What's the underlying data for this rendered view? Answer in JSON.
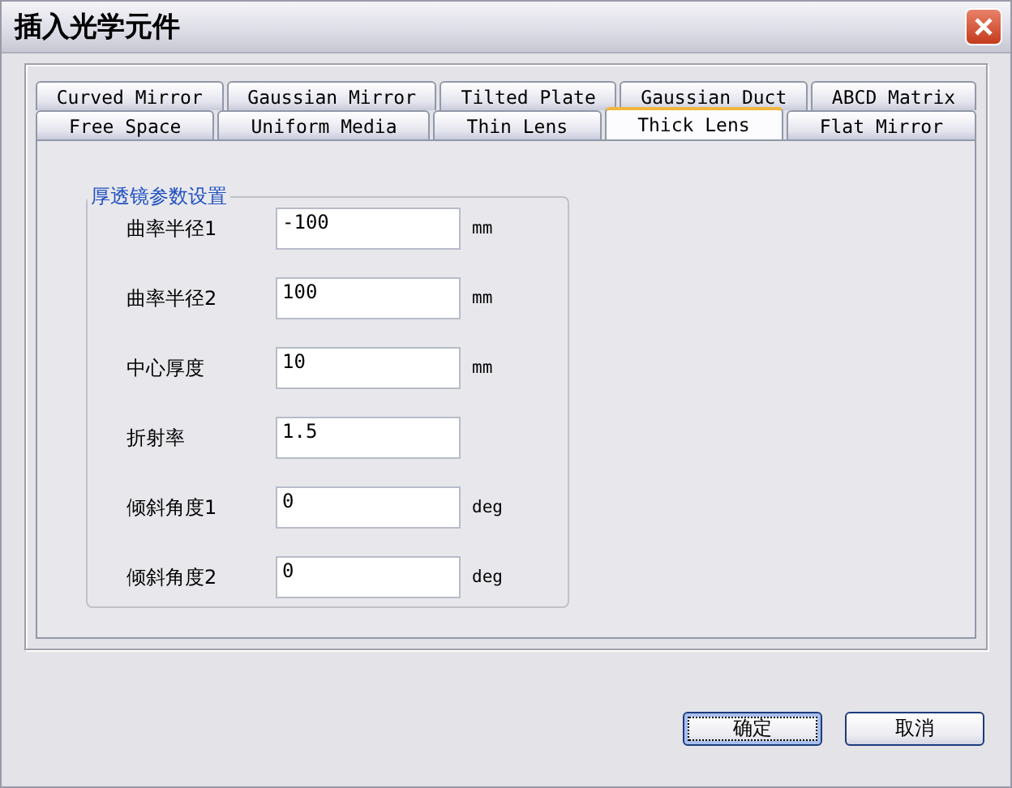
{
  "window": {
    "title": "插入光学元件"
  },
  "tab_rows": [
    {
      "tabs": [
        {
          "label": "Curved Mirror",
          "selected": false
        },
        {
          "label": "Gaussian Mirror",
          "selected": false
        },
        {
          "label": "Tilted Plate",
          "selected": false
        },
        {
          "label": "Gaussian Duct",
          "selected": false
        },
        {
          "label": "ABCD Matrix",
          "selected": false
        }
      ]
    },
    {
      "tabs": [
        {
          "label": "Free Space",
          "selected": false
        },
        {
          "label": "Uniform Media",
          "selected": false
        },
        {
          "label": "Thin Lens",
          "selected": false
        },
        {
          "label": "Thick Lens",
          "selected": true
        },
        {
          "label": "Flat Mirror",
          "selected": false
        }
      ]
    }
  ],
  "group": {
    "title": "厚透镜参数设置",
    "params": [
      {
        "label": "曲率半径1",
        "value": "-100",
        "unit": "mm"
      },
      {
        "label": "曲率半径2",
        "value": "100",
        "unit": "mm"
      },
      {
        "label": "中心厚度",
        "value": "10",
        "unit": "mm"
      },
      {
        "label": "折射率",
        "value": "1.5"
      },
      {
        "label": "倾斜角度1",
        "value": "0",
        "unit": "deg"
      },
      {
        "label": "倾斜角度2",
        "value": "0",
        "unit": "deg"
      }
    ]
  },
  "buttons": [
    {
      "label": "确定",
      "focused": true
    },
    {
      "label": "取消",
      "focused": false
    }
  ]
}
